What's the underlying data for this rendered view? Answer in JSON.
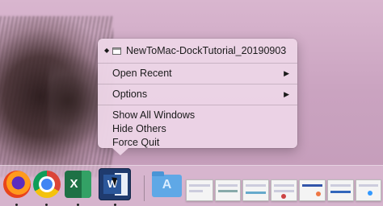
{
  "menu": {
    "window_title": "NewToMac-DockTutorial_20190903",
    "items": [
      {
        "label": "Open Recent",
        "has_submenu": true
      },
      {
        "label": "Options",
        "has_submenu": true
      },
      {
        "label": "Show All Windows"
      },
      {
        "label": "Hide Others"
      },
      {
        "label": "Force Quit"
      }
    ],
    "submenu_glyph": "▶",
    "current_glyph": "◆"
  },
  "dock": {
    "apps": [
      {
        "name": "Firefox",
        "icon": "firefox-icon",
        "running": true
      },
      {
        "name": "Google Chrome",
        "icon": "chrome-icon",
        "running": true
      },
      {
        "name": "Microsoft Excel",
        "icon": "excel-icon",
        "running": true,
        "letter": "X"
      },
      {
        "name": "Microsoft Word",
        "icon": "word-icon",
        "running": true,
        "letter": "W"
      }
    ],
    "folder_glyph": "A",
    "colors": {
      "accent_blue": "#5fa8e6",
      "excel_green": "#1e7145",
      "word_blue": "#2b579a"
    }
  }
}
